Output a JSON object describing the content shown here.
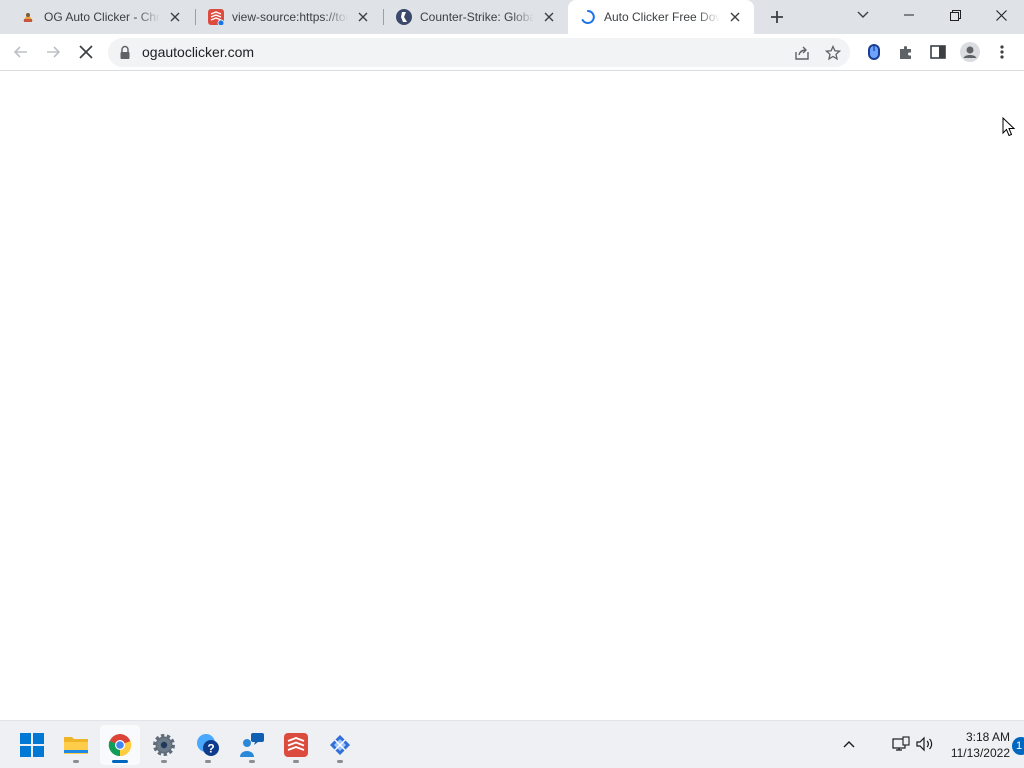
{
  "browser": {
    "tabs": [
      {
        "title": "OG Auto Clicker - Chrome",
        "favicon": "ogautoclicker-favicon-icon",
        "active": false
      },
      {
        "title": "view-source:https://toolbox",
        "favicon": "todoist-favicon-icon",
        "active": false
      },
      {
        "title": "Counter-Strike: Global Offensive",
        "favicon": "csgo-favicon-icon",
        "active": false
      },
      {
        "title": "Auto Clicker Free Download",
        "favicon": "loading-spinner-icon",
        "active": true
      }
    ],
    "new_tab_symbol": "+",
    "address": {
      "url": "ogautoclicker.com"
    }
  },
  "taskbar": {
    "apps": [
      {
        "name": "start-button",
        "icon": "windows-logo-icon"
      },
      {
        "name": "file-explorer",
        "icon": "folder-icon"
      },
      {
        "name": "google-chrome",
        "icon": "chrome-icon",
        "active": true
      },
      {
        "name": "settings",
        "icon": "gear-icon"
      },
      {
        "name": "get-help",
        "icon": "help-icon"
      },
      {
        "name": "feedback-hub",
        "icon": "chat-people-icon"
      },
      {
        "name": "todoist",
        "icon": "todoist-icon"
      },
      {
        "name": "snipping-tool",
        "icon": "diamond-tool-icon"
      }
    ],
    "clock": {
      "time": "3:18 AM",
      "date": "11/13/2022"
    },
    "notification_count": "1"
  },
  "colors": {
    "tabstrip_bg": "#dfe3e8",
    "active_tab_bg": "#ffffff",
    "omnibox_bg": "#f1f3f4",
    "accent": "#0067c0",
    "spinner": "#1a73e8"
  }
}
